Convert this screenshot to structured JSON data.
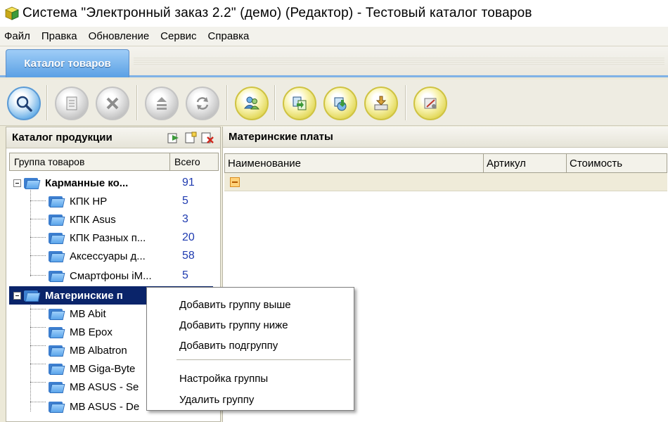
{
  "window": {
    "title": "Система \"Электронный заказ 2.2\" (демо)  (Редактор) - Тестовый  каталог товаров"
  },
  "menu": [
    "Файл",
    "Правка",
    "Обновление",
    "Сервис",
    "Справка"
  ],
  "tab": {
    "label": "Каталог товаров"
  },
  "toolbar_icons": [
    "search-icon",
    "document-icon",
    "delete-icon",
    "move-up-icon",
    "refresh-icon",
    "users-icon",
    "copy-icon",
    "import-icon",
    "export-icon",
    "settings-icon"
  ],
  "left_panel": {
    "title": "Каталог продукции",
    "columns": {
      "group": "Группа товаров",
      "total": "Всего"
    },
    "rows": [
      {
        "label": "Карманные ко...",
        "count": "91"
      },
      {
        "label": "КПК HP",
        "count": "5"
      },
      {
        "label": "КПК Asus",
        "count": "3"
      },
      {
        "label": "КПК Разных п...",
        "count": "20"
      },
      {
        "label": "Аксессуары д...",
        "count": "58"
      },
      {
        "label": "Смартфоны iM...",
        "count": "5"
      },
      {
        "label": "Материнские п",
        "count": ""
      },
      {
        "label": "MB Abit",
        "count": ""
      },
      {
        "label": "MB Epox",
        "count": ""
      },
      {
        "label": "MB Albatron",
        "count": ""
      },
      {
        "label": "MB Giga-Byte",
        "count": ""
      },
      {
        "label": "MB ASUS - Se",
        "count": ""
      },
      {
        "label": "MB ASUS - De",
        "count": ""
      }
    ]
  },
  "right_panel": {
    "title": "Материнские платы",
    "columns": [
      "Наименование",
      "Артикул",
      "Стоимость"
    ]
  },
  "context_menu": {
    "items": [
      "Добавить группу выше",
      "Добавить группу ниже",
      "Добавить подгруппу",
      "Настройка группы",
      "Удалить группу"
    ]
  }
}
